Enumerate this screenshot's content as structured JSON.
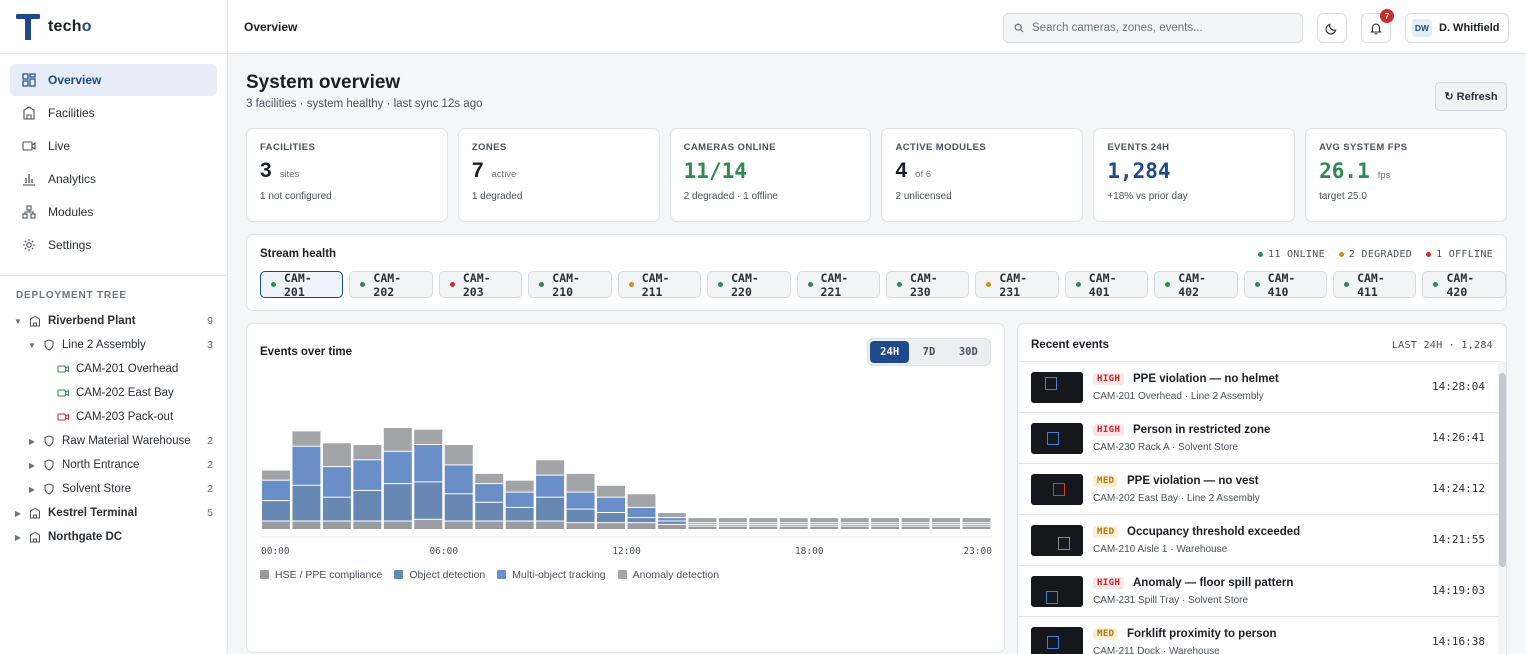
{
  "brand": {
    "name_prefix": "tech",
    "name_suffix": "o"
  },
  "nav": {
    "items": [
      {
        "label": "Overview",
        "icon": "grid-icon",
        "active": true
      },
      {
        "label": "Facilities",
        "icon": "building-icon"
      },
      {
        "label": "Live",
        "icon": "video-icon"
      },
      {
        "label": "Analytics",
        "icon": "bar-chart-icon"
      },
      {
        "label": "Modules",
        "icon": "modules-icon"
      },
      {
        "label": "Settings",
        "icon": "gear-icon"
      }
    ]
  },
  "tree": {
    "title": "DEPLOYMENT TREE",
    "nodes": [
      {
        "label": "Riverbend Plant",
        "count": "9",
        "level": 0,
        "expanded": true,
        "kind": "facility"
      },
      {
        "label": "Line 2 Assembly",
        "count": "3",
        "level": 1,
        "expanded": true,
        "kind": "zone"
      },
      {
        "label": "CAM-201 Overhead",
        "count": "",
        "level": 2,
        "kind": "camera",
        "status": "online"
      },
      {
        "label": "CAM-202 East Bay",
        "count": "",
        "level": 2,
        "kind": "camera",
        "status": "online"
      },
      {
        "label": "CAM-203 Pack-out",
        "count": "",
        "level": 2,
        "kind": "camera",
        "status": "offline"
      },
      {
        "label": "Raw Material Warehouse",
        "count": "2",
        "level": 1,
        "kind": "zone"
      },
      {
        "label": "North Entrance",
        "count": "2",
        "level": 1,
        "kind": "zone"
      },
      {
        "label": "Solvent Store",
        "count": "2",
        "level": 1,
        "kind": "zone"
      },
      {
        "label": "Kestrel Terminal",
        "count": "5",
        "level": 0,
        "kind": "facility"
      },
      {
        "label": "Northgate DC",
        "count": "",
        "level": 0,
        "kind": "facility"
      }
    ]
  },
  "topbar": {
    "breadcrumb": "Overview",
    "search_placeholder": "Search cameras, zones, events...",
    "notifications_count": "7",
    "user_initials": "DW",
    "user_name": "D. Whitfield"
  },
  "overview": {
    "title": "System overview",
    "subtitle": "3 facilities · system healthy · last sync 12s ago",
    "refresh_label": "↻ Refresh"
  },
  "kpis": [
    {
      "label": "FACILITIES",
      "value": "3",
      "unit": "sites",
      "note": "1 not configured",
      "color": "#1c1f26",
      "mono": false
    },
    {
      "label": "ZONES",
      "value": "7",
      "unit": "active",
      "note": "1 degraded",
      "color": "#1c1f26",
      "mono": false
    },
    {
      "label": "CAMERAS ONLINE",
      "value": "11/14",
      "unit": "",
      "note": "2 degraded · 1 offline",
      "color": "#2e8a4e",
      "mono": true
    },
    {
      "label": "ACTIVE MODULES",
      "value": "4",
      "unit": "of 6",
      "note": "2 unlicensed",
      "color": "#1c1f26",
      "mono": false
    },
    {
      "label": "EVENTS 24H",
      "value": "1,284",
      "unit": "",
      "note": "+18% vs prior day",
      "color": "#1d4a8c",
      "mono": true
    },
    {
      "label": "AVG SYSTEM FPS",
      "value": "26.1",
      "unit": "fps",
      "note": "target 25.0",
      "color": "#2e8a4e",
      "mono": true
    }
  ],
  "stream_health": {
    "title": "Stream health",
    "legend": [
      {
        "label": "11 ONLINE",
        "color": "#2e8a4e"
      },
      {
        "label": "2 DEGRADED",
        "color": "#d98a1a"
      },
      {
        "label": "1 OFFLINE",
        "color": "#d12a2a"
      }
    ],
    "cameras": [
      {
        "id": "CAM-201",
        "status": "#2e8a4e",
        "selected": true
      },
      {
        "id": "CAM-202",
        "status": "#2e8a4e"
      },
      {
        "id": "CAM-203",
        "status": "#d12a2a"
      },
      {
        "id": "CAM-210",
        "status": "#2e8a4e"
      },
      {
        "id": "CAM-211",
        "status": "#d98a1a"
      },
      {
        "id": "CAM-220",
        "status": "#2e8a4e"
      },
      {
        "id": "CAM-221",
        "status": "#2e8a4e"
      },
      {
        "id": "CAM-230",
        "status": "#2e8a4e"
      },
      {
        "id": "CAM-231",
        "status": "#d98a1a"
      },
      {
        "id": "CAM-401",
        "status": "#2e8a4e"
      },
      {
        "id": "CAM-402",
        "status": "#2e8a4e"
      },
      {
        "id": "CAM-410",
        "status": "#2e8a4e"
      },
      {
        "id": "CAM-411",
        "status": "#2e8a4e"
      },
      {
        "id": "CAM-420",
        "status": "#2e8a4e"
      }
    ]
  },
  "events_chart": {
    "title": "Events over time",
    "ranges": [
      "24H",
      "7D",
      "30D"
    ],
    "active_range": "24H"
  },
  "chart_data": {
    "type": "bar",
    "stacked": true,
    "categories": [
      "00:00",
      "01:00",
      "02:00",
      "03:00",
      "04:00",
      "05:00",
      "06:00",
      "07:00",
      "08:00",
      "09:00",
      "10:00",
      "11:00",
      "12:00",
      "13:00",
      "14:00",
      "15:00",
      "16:00",
      "17:00",
      "18:00",
      "19:00",
      "20:00",
      "21:00",
      "22:00",
      "23:00"
    ],
    "x_tick_labels": [
      "00:00",
      "06:00",
      "12:00",
      "18:00",
      "23:00"
    ],
    "series": [
      {
        "name": "HSE / PPE compliance",
        "color": "#9a9ca1",
        "values": [
          5,
          5,
          5,
          5,
          5,
          6,
          5,
          5,
          5,
          5,
          4,
          4,
          4,
          3,
          2,
          2,
          2,
          2,
          2,
          2,
          2,
          2,
          2,
          2
        ]
      },
      {
        "name": "Object detection",
        "color": "#6888b4",
        "values": [
          12,
          21,
          14,
          18,
          22,
          22,
          16,
          11,
          8,
          14,
          8,
          6,
          3,
          2,
          1,
          1,
          1,
          1,
          1,
          1,
          1,
          1,
          1,
          1
        ]
      },
      {
        "name": "Multi-object tracking",
        "color": "#6a8fc8",
        "values": [
          12,
          23,
          18,
          18,
          19,
          22,
          17,
          11,
          9,
          13,
          10,
          9,
          6,
          2,
          1,
          1,
          1,
          1,
          1,
          1,
          1,
          1,
          1,
          1
        ]
      },
      {
        "name": "Anomaly detection",
        "color": "#a2a4a8",
        "values": [
          6,
          9,
          14,
          9,
          14,
          9,
          12,
          6,
          7,
          9,
          11,
          7,
          8,
          3,
          3,
          3,
          3,
          3,
          3,
          3,
          3,
          3,
          3,
          3
        ]
      }
    ]
  },
  "recent_events": {
    "title": "Recent events",
    "meta": "LAST 24H · 1,284",
    "items": [
      {
        "severity": "HIGH",
        "title": "PPE violation — no helmet",
        "source": "CAM-201 Overhead · Line 2 Assembly",
        "time": "14:28:04",
        "box_color": "#3f7fd6"
      },
      {
        "severity": "HIGH",
        "title": "Person in restricted zone",
        "source": "CAM-230 Rack A · Solvent Store",
        "time": "14:26:41",
        "box_color": "#3f7fd6"
      },
      {
        "severity": "MED",
        "title": "PPE violation — no vest",
        "source": "CAM-202 East Bay · Line 2 Assembly",
        "time": "14:24:12",
        "box_color": "#d23a2a"
      },
      {
        "severity": "MED",
        "title": "Occupancy threshold exceeded",
        "source": "CAM-210 Aisle 1 · Warehouse",
        "time": "14:21:55",
        "box_color": "#8a8d94"
      },
      {
        "severity": "HIGH",
        "title": "Anomaly — floor spill pattern",
        "source": "CAM-231 Spill Tray · Solvent Store",
        "time": "14:19:03",
        "box_color": "#3f7fd6"
      },
      {
        "severity": "MED",
        "title": "Forklift proximity to person",
        "source": "CAM-211 Dock · Warehouse",
        "time": "14:16:38",
        "box_color": "#3f7fd6"
      }
    ]
  }
}
